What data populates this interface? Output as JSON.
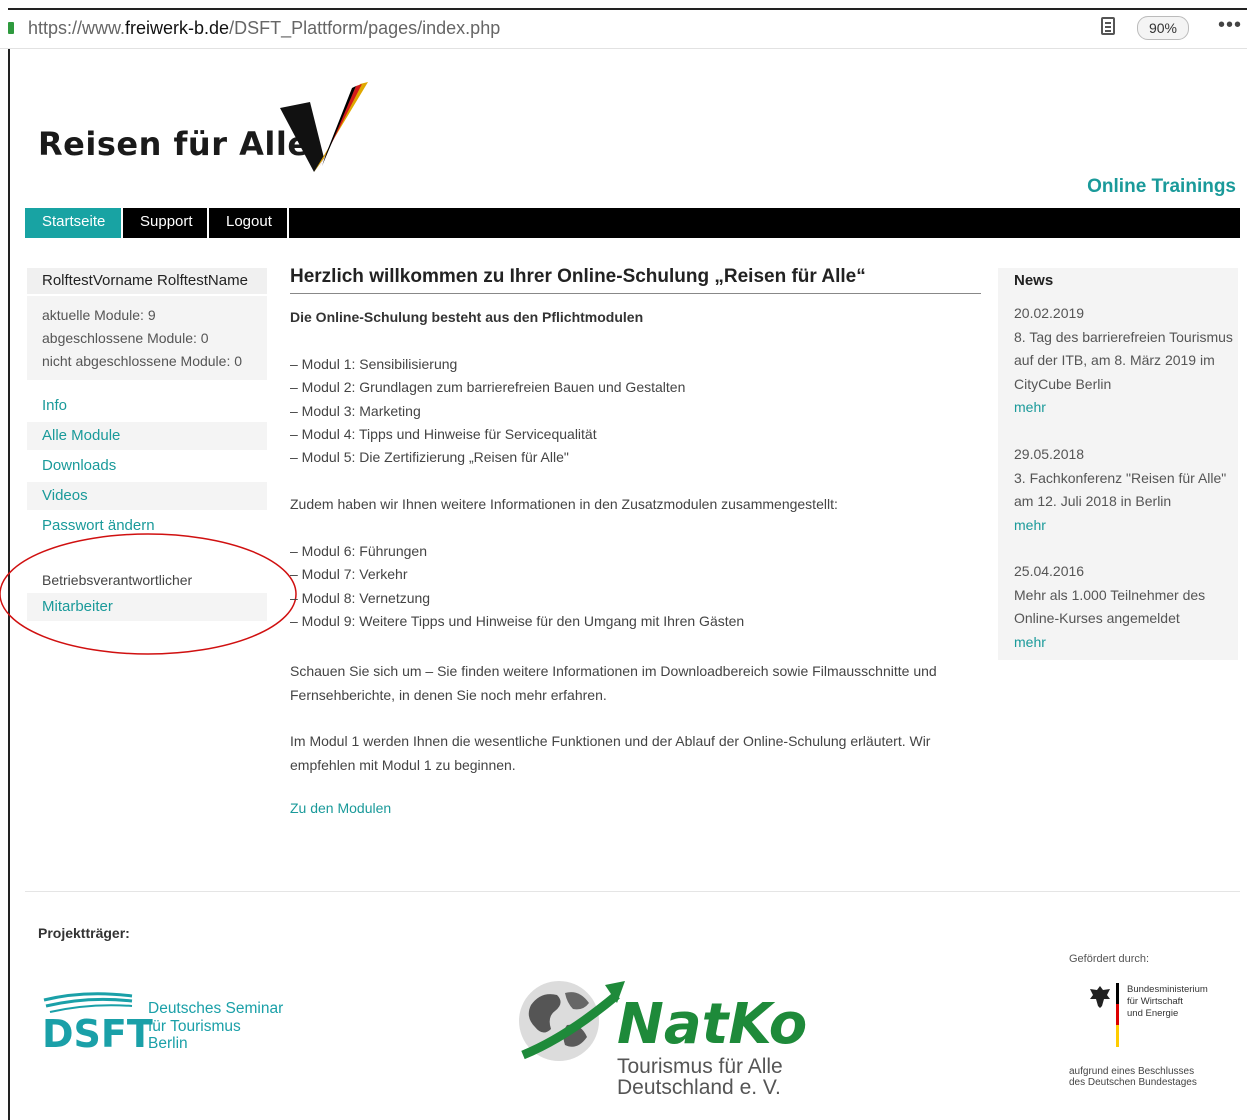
{
  "browser": {
    "url_prefix": "https://www.",
    "url_domain": "freiwerk-b.de",
    "url_path": "/DSFT_Plattform/pages/index.php",
    "zoom": "90%",
    "more": "•••"
  },
  "header": {
    "logo_text": "Reisen für Alle",
    "online_trainings": "Online Trainings"
  },
  "nav": {
    "items": [
      {
        "label": "Startseite"
      },
      {
        "label": "Support"
      },
      {
        "label": "Logout"
      }
    ]
  },
  "sidebar": {
    "user": "RolftestVorname RolftestName",
    "stats": [
      "aktuelle Module: 9",
      "abgeschlossene Module: 0",
      "nicht abgeschlossene Module: 0"
    ],
    "links": [
      "Info",
      "Alle Module",
      "Downloads",
      "Videos",
      "Passwort ändern"
    ],
    "role_label": "Betriebsverantwortlicher",
    "role_link": "Mitarbeiter"
  },
  "main": {
    "title": "Herzlich willkommen zu Ihrer Online-Schulung „Reisen für Alle“",
    "intro": "Die Online-Schulung besteht aus den Pflichtmodulen",
    "mandatory": [
      "– Modul 1: Sensibilisierung",
      "– Modul 2: Grundlagen zum barrierefreien Bauen und Gestalten",
      "– Modul 3: Marketing",
      "– Modul 4: Tipps und Hinweise für Servicequalität",
      "– Modul 5: Die Zertifizierung „Reisen für Alle\""
    ],
    "additional_intro": "Zudem haben wir Ihnen weitere Informationen in den Zusatzmodulen zusammengestellt:",
    "additional": [
      "– Modul 6: Führungen",
      "– Modul 7: Verkehr",
      "– Modul 8: Vernetzung",
      "– Modul 9: Weitere Tipps und Hinweise für den Umgang mit Ihren Gästen"
    ],
    "para1_line1": "Schauen Sie sich um – Sie finden weitere Informationen im Downloadbereich sowie Filmausschnitte und",
    "para1_line2": "Fernsehberichte, in denen Sie noch mehr erfahren.",
    "para2_line1": "Im Modul 1 werden Ihnen die wesentliche Funktionen und der Ablauf der Online-Schulung erläutert. Wir",
    "para2_line2": "empfehlen mit Modul 1 zu beginnen.",
    "cta": "Zu den Modulen"
  },
  "news": {
    "heading": "News",
    "items": [
      {
        "date": "20.02.2019",
        "lines": [
          "8. Tag des barrierefreien Tourismus",
          "auf der ITB, am 8. März 2019 im",
          "CityCube Berlin"
        ],
        "more": "mehr"
      },
      {
        "date": "29.05.2018",
        "lines": [
          "3. Fachkonferenz \"Reisen für Alle\"",
          "am 12. Juli 2018 in Berlin"
        ],
        "more": "mehr"
      },
      {
        "date": "25.04.2016",
        "lines": [
          "Mehr als 1.000 Teilnehmer des",
          "Online-Kurses angemeldet"
        ],
        "more": "mehr"
      }
    ]
  },
  "footer": {
    "projekt_label": "Projektträger:",
    "dsft_abbr": "DSFT",
    "dsft_name": [
      "Deutsches Seminar",
      "für Tourismus",
      "Berlin"
    ],
    "natko": "NatKo",
    "natko_sub": [
      "Tourismus für Alle",
      "Deutschland e. V."
    ],
    "gefoerdert": "Gefördert durch:",
    "bmwi": [
      "Bundesministerium",
      "für Wirtschaft",
      "und Energie"
    ],
    "beschluss": [
      "aufgrund eines Beschlusses",
      "des Deutschen Bundestages"
    ]
  },
  "colors": {
    "accent": "#1a9a9a",
    "nav_bg": "#000000",
    "active_tab": "#18a3a3",
    "annotation": "#d01010"
  }
}
